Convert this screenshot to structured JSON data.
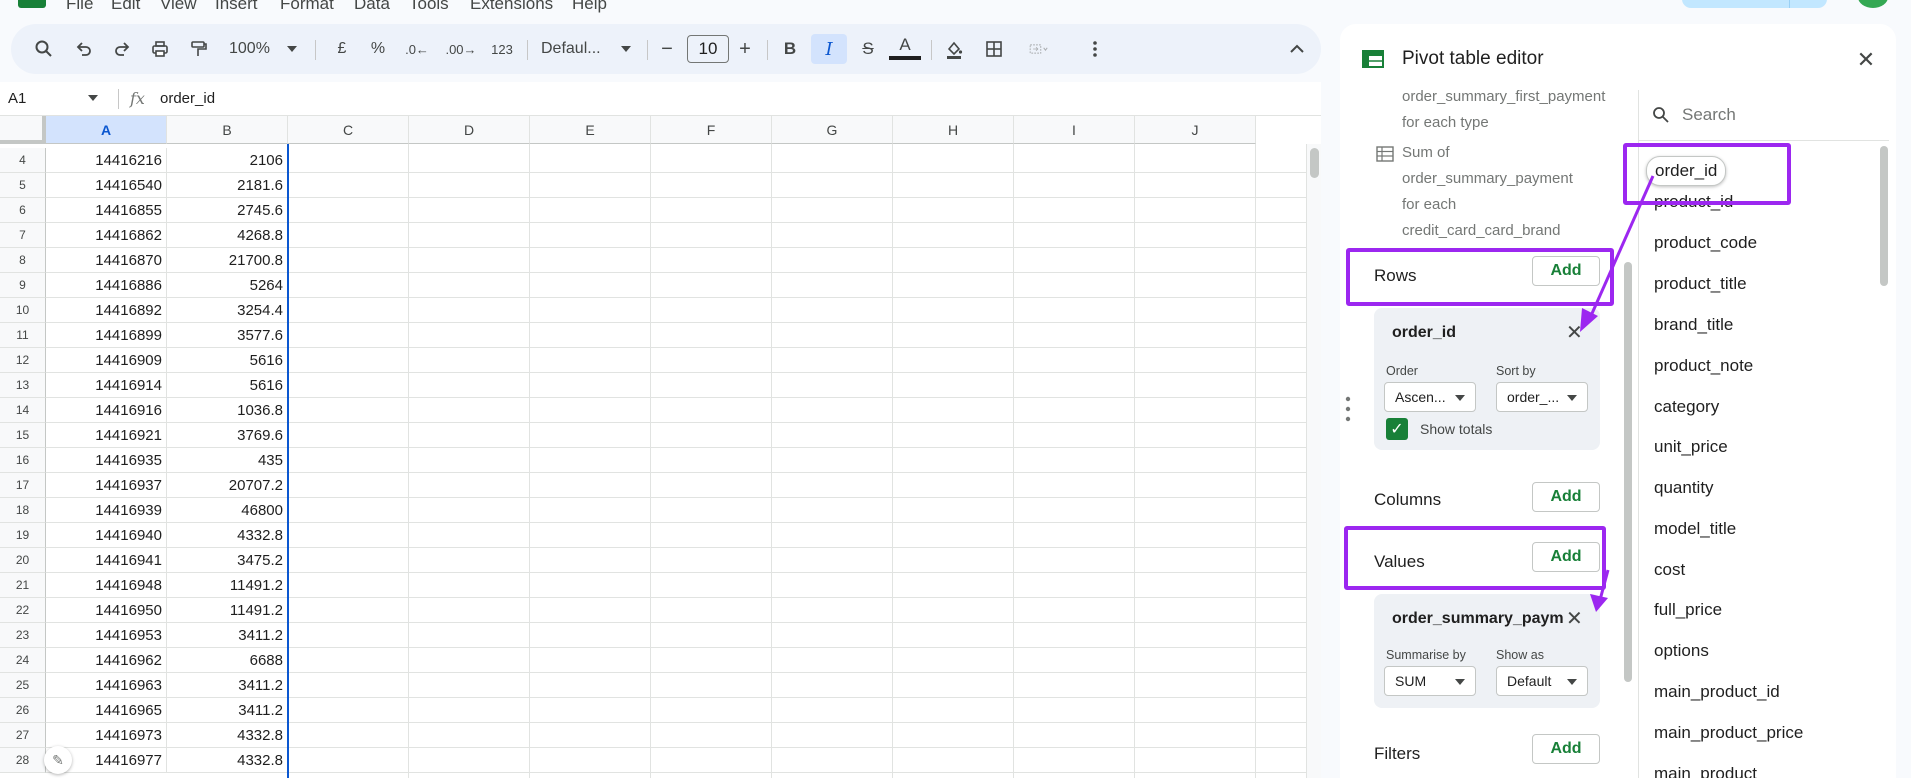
{
  "menu": [
    "File",
    "Edit",
    "View",
    "Insert",
    "Format",
    "Data",
    "Tools",
    "Extensions",
    "Help"
  ],
  "toolbar": {
    "zoom": "100%",
    "currency": "£",
    "percent": "%",
    "dec_decrease": ".0←",
    "dec_increase": ".00→",
    "format_123": "123",
    "font": "Defaul...",
    "font_size": "10",
    "minus": "−",
    "plus": "+",
    "bold": "B",
    "italic": "I",
    "strike": "S",
    "text_color": "A"
  },
  "formula_bar": {
    "name_box": "A1",
    "fx": "fx",
    "formula": "order_id"
  },
  "columns": [
    "A",
    "B",
    "C",
    "D",
    "E",
    "F",
    "G",
    "H",
    "I",
    "J"
  ],
  "rows": [
    {
      "n": "4",
      "a": "14416216",
      "b": "2106"
    },
    {
      "n": "5",
      "a": "14416540",
      "b": "2181.6"
    },
    {
      "n": "6",
      "a": "14416855",
      "b": "2745.6"
    },
    {
      "n": "7",
      "a": "14416862",
      "b": "4268.8"
    },
    {
      "n": "8",
      "a": "14416870",
      "b": "21700.8"
    },
    {
      "n": "9",
      "a": "14416886",
      "b": "5264"
    },
    {
      "n": "10",
      "a": "14416892",
      "b": "3254.4"
    },
    {
      "n": "11",
      "a": "14416899",
      "b": "3577.6"
    },
    {
      "n": "12",
      "a": "14416909",
      "b": "5616"
    },
    {
      "n": "13",
      "a": "14416914",
      "b": "5616"
    },
    {
      "n": "14",
      "a": "14416916",
      "b": "1036.8"
    },
    {
      "n": "15",
      "a": "14416921",
      "b": "3769.6"
    },
    {
      "n": "16",
      "a": "14416935",
      "b": "435"
    },
    {
      "n": "17",
      "a": "14416937",
      "b": "20707.2"
    },
    {
      "n": "18",
      "a": "14416939",
      "b": "46800"
    },
    {
      "n": "19",
      "a": "14416940",
      "b": "4332.8"
    },
    {
      "n": "20",
      "a": "14416941",
      "b": "3475.2"
    },
    {
      "n": "21",
      "a": "14416948",
      "b": "11491.2"
    },
    {
      "n": "22",
      "a": "14416950",
      "b": "11491.2"
    },
    {
      "n": "23",
      "a": "14416953",
      "b": "3411.2"
    },
    {
      "n": "24",
      "a": "14416962",
      "b": "6688"
    },
    {
      "n": "25",
      "a": "14416963",
      "b": "3411.2"
    },
    {
      "n": "26",
      "a": "14416965",
      "b": "3411.2"
    },
    {
      "n": "27",
      "a": "14416973",
      "b": "4332.8"
    },
    {
      "n": "28",
      "a": "14416977",
      "b": "4332.8"
    }
  ],
  "pivot": {
    "title": "Pivot table editor",
    "suggestion_1_lines": [
      "order_summary_first_payment",
      "for each type"
    ],
    "suggestion_2_lines": [
      "Sum of",
      "order_summary_payment",
      "for each",
      "credit_card_card_brand"
    ],
    "rows_label": "Rows",
    "columns_label": "Columns",
    "values_label": "Values",
    "filters_label": "Filters",
    "add_label": "Add",
    "row_card": {
      "title": "order_id",
      "order_label": "Order",
      "order_value": "Ascen...",
      "sortby_label": "Sort by",
      "sortby_value": "order_...",
      "show_totals": "Show totals"
    },
    "value_card": {
      "title": "order_summary_paym",
      "summarise_label": "Summarise by",
      "summarise_value": "SUM",
      "showas_label": "Show as",
      "showas_value": "Default"
    },
    "search_placeholder": "Search",
    "fields": [
      "order_id",
      "product_id",
      "product_code",
      "product_title",
      "brand_title",
      "product_note",
      "category",
      "unit_price",
      "quantity",
      "model_title",
      "cost",
      "full_price",
      "options",
      "main_product_id",
      "main_product_price",
      "main_product"
    ]
  },
  "colors": {
    "highlight": "#9c27f0",
    "accent_green": "#188038",
    "selection_blue": "#0b57d0"
  }
}
